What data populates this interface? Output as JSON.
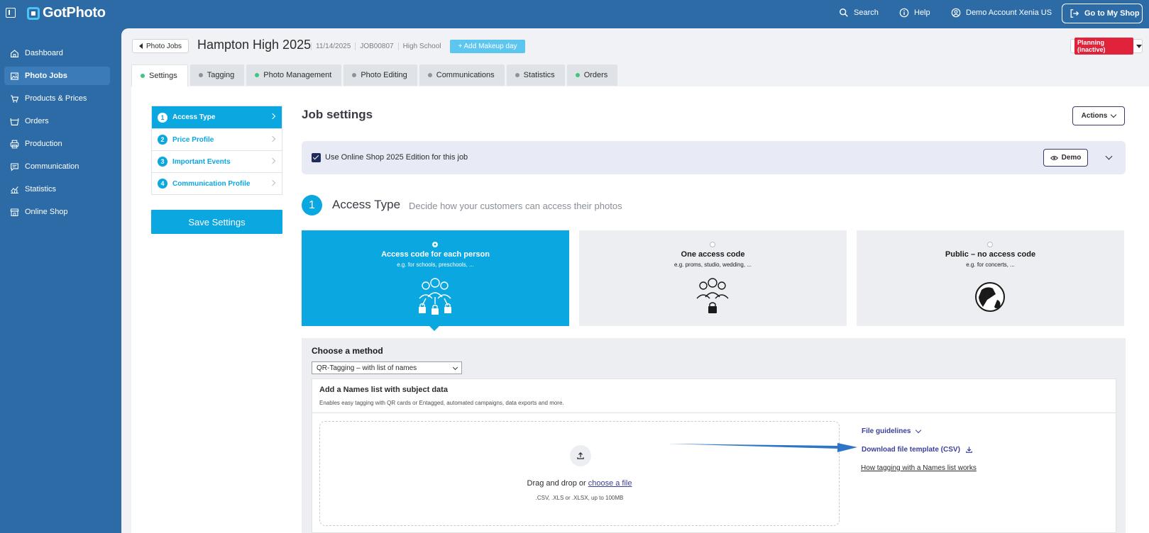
{
  "topbar": {
    "logo": "GotPhoto",
    "search": "Search",
    "help": "Help",
    "account": "Demo Account Xenia US",
    "shop_button": "Go to My Shop"
  },
  "sidebar": {
    "items": [
      {
        "label": "Dashboard",
        "icon": "home-icon"
      },
      {
        "label": "Photo Jobs",
        "icon": "image-icon",
        "active": true
      },
      {
        "label": "Products & Prices",
        "icon": "cart-icon"
      },
      {
        "label": "Orders",
        "icon": "basket-icon"
      },
      {
        "label": "Production",
        "icon": "printer-icon"
      },
      {
        "label": "Communication",
        "icon": "chat-icon"
      },
      {
        "label": "Statistics",
        "icon": "chart-icon"
      },
      {
        "label": "Online Shop",
        "icon": "store-icon"
      }
    ]
  },
  "header": {
    "back_label": "Photo Jobs",
    "title": "Hampton High 2025",
    "date": "11/14/2025",
    "job_id": "JOB00807",
    "category": "High School",
    "makeup_button": "+ Add Makeup day",
    "status": "Planning (inactive)"
  },
  "tabs": [
    {
      "label": "Settings",
      "status": "green",
      "active": true
    },
    {
      "label": "Tagging",
      "status": "gray"
    },
    {
      "label": "Photo Management",
      "status": "green"
    },
    {
      "label": "Photo Editing",
      "status": "gray"
    },
    {
      "label": "Communications",
      "status": "gray"
    },
    {
      "label": "Statistics",
      "status": "gray"
    },
    {
      "label": "Orders",
      "status": "green"
    }
  ],
  "steps": [
    {
      "num": "1",
      "label": "Access Type",
      "active": true
    },
    {
      "num": "2",
      "label": "Price Profile"
    },
    {
      "num": "3",
      "label": "Important Events"
    },
    {
      "num": "4",
      "label": "Communication Profile"
    }
  ],
  "save_button": "Save Settings",
  "job_settings": {
    "title": "Job settings",
    "actions_button": "Actions",
    "edition_label": "Use Online Shop 2025 Edition for this job",
    "edition_checked": true,
    "demo_button": "Demo"
  },
  "access_type": {
    "number": "1",
    "title": "Access Type",
    "subtitle": "Decide how your customers can access their photos",
    "options": [
      {
        "title": "Access code for each person",
        "sub": "e.g. for schools, preschools, ...",
        "selected": true
      },
      {
        "title": "One access code",
        "sub": "e.g. proms, studio, wedding, ..."
      },
      {
        "title": "Public – no access code",
        "sub": "e.g. for concerts, ..."
      }
    ]
  },
  "method": {
    "title": "Choose a method",
    "selected": "QR-Tagging – with list of names",
    "names_title": "Add a Names list with subject data",
    "names_sub": "Enables easy tagging with QR cards or Entagged, automated campaigns, data exports and more.",
    "drop_text": "Drag and drop or ",
    "drop_link": "choose a file",
    "drop_hint": ".CSV, .XLS or .XLSX, up to 100MB",
    "file_guidelines": "File guidelines",
    "download_template": "Download file template (CSV)",
    "how_link": "How tagging with a Names list works"
  },
  "colors": {
    "brand": "#2d6ba6",
    "accent": "#0aa7e0",
    "status_red": "#e0223b",
    "link": "#3b3f9a"
  }
}
